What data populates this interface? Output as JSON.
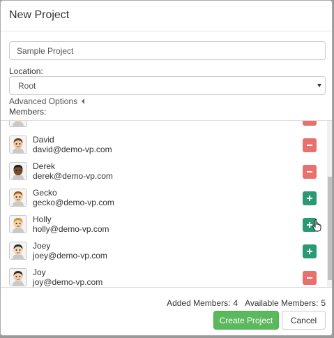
{
  "dialog": {
    "title": "New Project",
    "project_name_value": "Sample Project",
    "location_label": "Location:",
    "location_value": "Root",
    "advanced_options_label": "Advanced Options",
    "members_label": "Members:"
  },
  "members": [
    {
      "name": "",
      "email": "",
      "action": "remove"
    },
    {
      "name": "David",
      "email": "david@demo-vp.com",
      "action": "remove"
    },
    {
      "name": "Derek",
      "email": "derek@demo-vp.com",
      "action": "remove"
    },
    {
      "name": "Gecko",
      "email": "gecko@demo-vp.com",
      "action": "add"
    },
    {
      "name": "Holly",
      "email": "holly@demo-vp.com",
      "action": "add"
    },
    {
      "name": "Joey",
      "email": "joey@demo-vp.com",
      "action": "add"
    },
    {
      "name": "Joy",
      "email": "joy@demo-vp.com",
      "action": "remove"
    }
  ],
  "footer": {
    "added_members_label": "Added Members:",
    "added_members_count": "4",
    "available_members_label": "Available Members:",
    "available_members_count": "5",
    "create_label": "Create Project",
    "cancel_label": "Cancel"
  },
  "colors": {
    "remove": "#e8706d",
    "add": "#2a9a74",
    "primary": "#5cb85c"
  },
  "icons": {
    "remove": "minus-icon",
    "add": "plus-icon",
    "advanced_toggle": "caret-left-icon",
    "select": "caret-down-icon"
  }
}
